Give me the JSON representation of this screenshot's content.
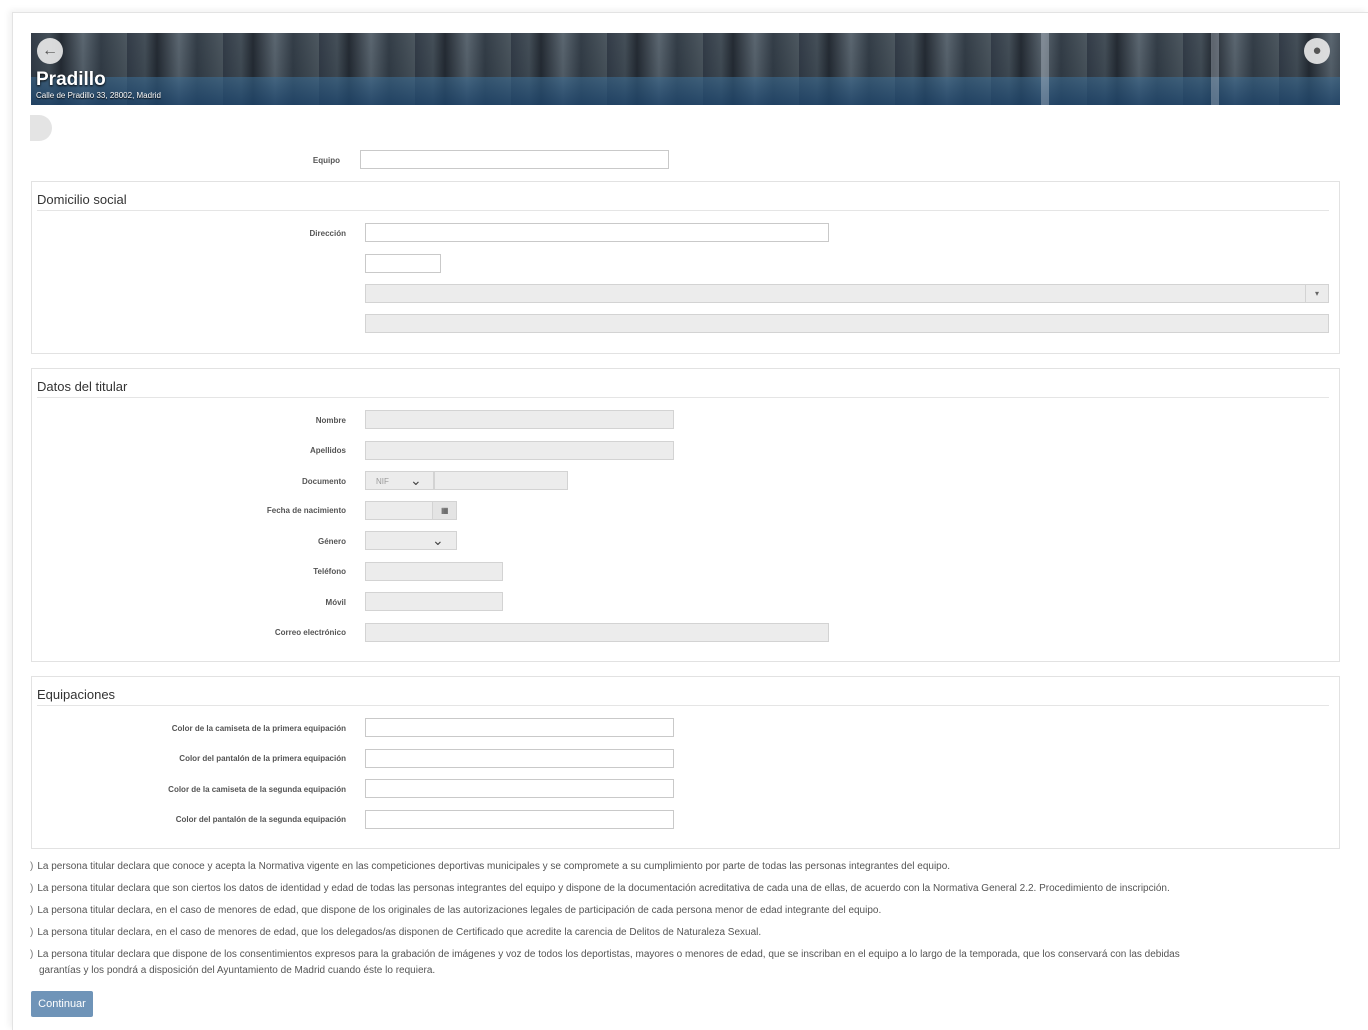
{
  "header": {
    "title": "Pradillo",
    "address": "Calle de Pradillo 33, 28002, Madrid"
  },
  "team": {
    "label": "Equipo"
  },
  "domicilio": {
    "legend": "Domicilio social",
    "direccion_label": "Dirección"
  },
  "titular": {
    "legend": "Datos del titular",
    "nombre_label": "Nombre",
    "apellidos_label": "Apellidos",
    "documento_label": "Documento",
    "documento_type": "NIF",
    "fecha_label": "Fecha de nacimiento",
    "genero_label": "Género",
    "telefono_label": "Teléfono",
    "movil_label": "Móvil",
    "correo_label": "Correo electrónico"
  },
  "equipaciones": {
    "legend": "Equipaciones",
    "camiseta1_label": "Color de la camiseta de la primera equipación",
    "pantalon1_label": "Color del pantalón de la primera equipación",
    "camiseta2_label": "Color de la camiseta de la segunda equipación",
    "pantalon2_label": "Color del pantalón de la segunda equipación"
  },
  "declarations": [
    "La persona titular declara que conoce y acepta la Normativa vigente en las competiciones deportivas municipales y se compromete a su cumplimiento por parte de todas las personas integrantes del equipo.",
    "La persona titular declara que son ciertos los datos de identidad y edad de todas las personas integrantes del equipo y dispone de la documentación acreditativa de cada una de ellas, de acuerdo con la Normativa General 2.2. Procedimiento de inscripción.",
    "La persona titular declara, en el caso de menores de edad, que dispone de los originales de las autorizaciones legales de participación de cada persona menor de edad integrante del equipo.",
    "La persona titular declara, en el caso de menores de edad, que los delegados/as disponen de Certificado que acredite la carencia de Delitos de Naturaleza Sexual.",
    "La persona titular declara que dispone de los consentimientos expresos para la grabación de imágenes y voz de todos los deportistas, mayores o menores de edad, que se inscriban en el equipo a lo largo de la temporada, que los conservará con las debidas",
    "garantías y los pondrá a disposición del Ayuntamiento de Madrid cuando éste lo requiera."
  ],
  "continue_label": "Continuar",
  "icons": {
    "back": "arrow-left-icon",
    "globe": "globe-icon",
    "calendar": "calendar-icon",
    "chevron": "chevron-down-icon"
  }
}
